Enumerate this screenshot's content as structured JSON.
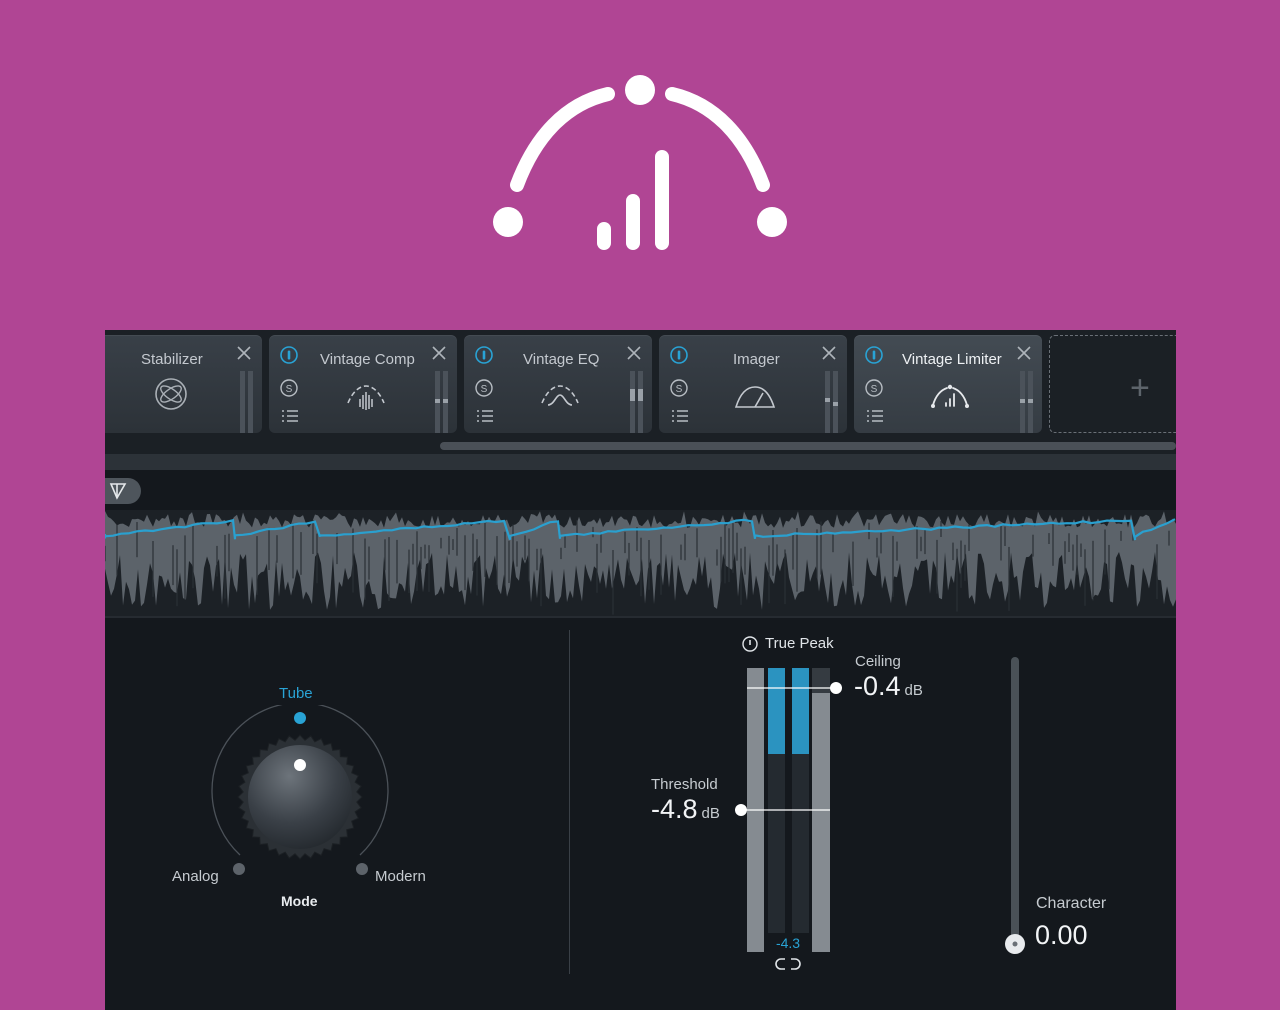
{
  "modules": [
    {
      "name": "Stabilizer",
      "active": false
    },
    {
      "name": "Vintage Comp",
      "active": false
    },
    {
      "name": "Vintage EQ",
      "active": false
    },
    {
      "name": "Imager",
      "active": false
    },
    {
      "name": "Vintage Limiter",
      "active": true
    }
  ],
  "add_slot": {
    "icon": "plus-icon"
  },
  "controls": {
    "mode": {
      "title": "Mode",
      "options": [
        "Analog",
        "Tube",
        "Modern"
      ],
      "selected": "Tube"
    },
    "true_peak": {
      "label": "True Peak"
    },
    "ceiling": {
      "label": "Ceiling",
      "value": "-0.4",
      "unit": "dB"
    },
    "threshold": {
      "label": "Threshold",
      "value": "-4.8",
      "unit": "dB"
    },
    "gain_reduction": {
      "value": "-4.3"
    },
    "character": {
      "label": "Character",
      "value": "0.00"
    }
  },
  "colors": {
    "accent": "#29a3d5",
    "background": "#b04594",
    "panel": "#14181d"
  }
}
